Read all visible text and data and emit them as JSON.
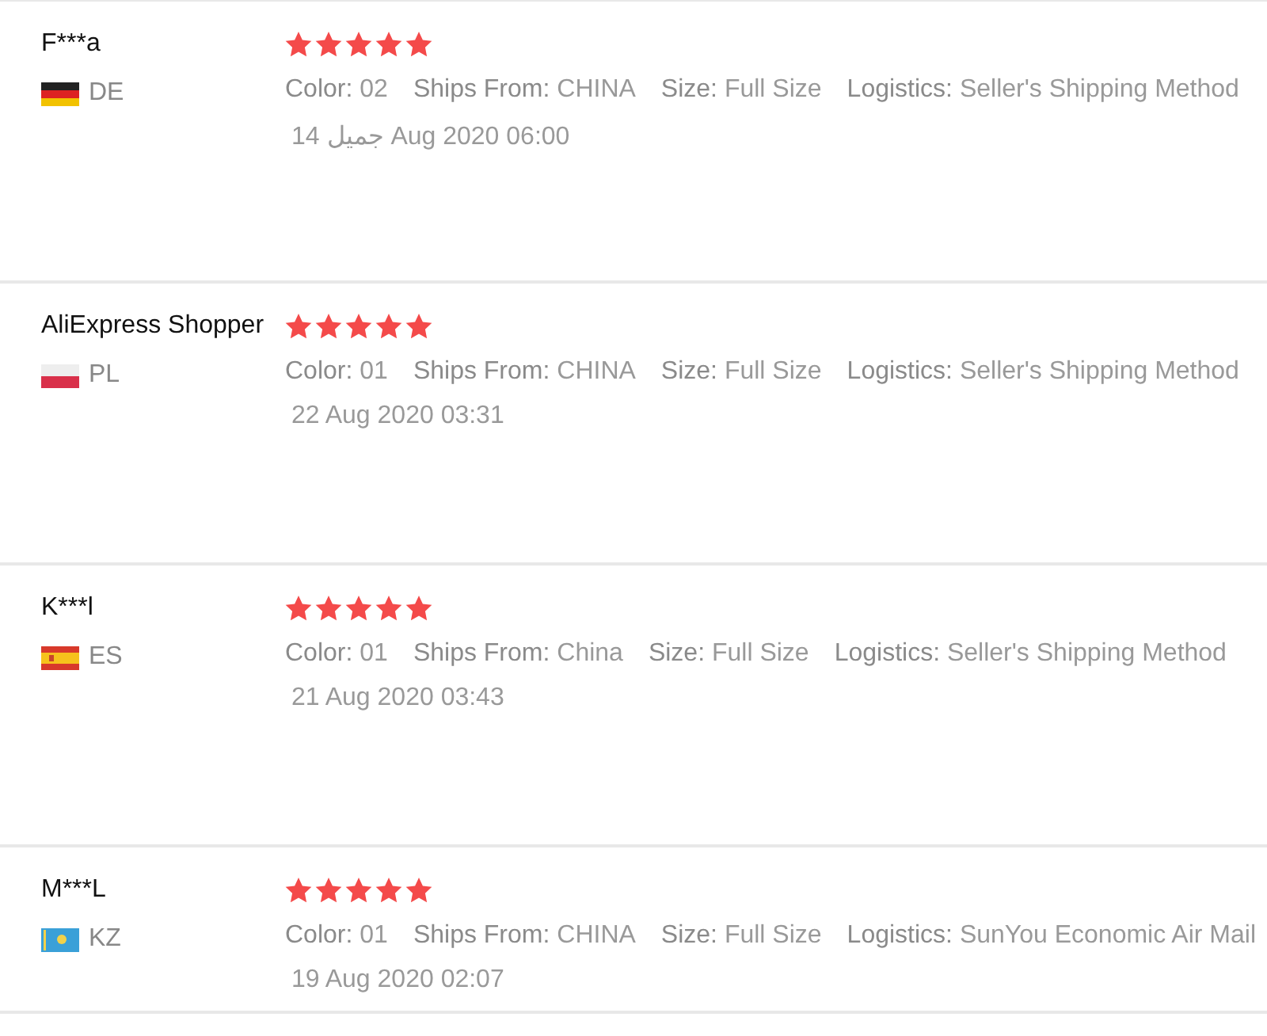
{
  "reviews": [
    {
      "name": "F***a",
      "flag": {
        "kind": "de"
      },
      "country": "DE",
      "stars": 5,
      "attributes": [
        {
          "label": "Color:",
          "value": "02"
        },
        {
          "label": "Ships From:",
          "value": "CHINA"
        },
        {
          "label": "Size:",
          "value": "Full Size"
        },
        {
          "label": "Logistics:",
          "value": "Seller's Shipping Method"
        }
      ],
      "date": "14 جميل Aug 2020 06:00"
    },
    {
      "name": "AliExpress Shopper",
      "flag": {
        "kind": "pl"
      },
      "country": "PL",
      "stars": 5,
      "attributes": [
        {
          "label": "Color:",
          "value": "01"
        },
        {
          "label": "Ships From:",
          "value": "CHINA"
        },
        {
          "label": "Size:",
          "value": "Full Size"
        },
        {
          "label": "Logistics:",
          "value": "Seller's Shipping Method"
        }
      ],
      "date": "22 Aug 2020 03:31"
    },
    {
      "name": "K***l",
      "flag": {
        "kind": "es"
      },
      "country": "ES",
      "stars": 5,
      "attributes": [
        {
          "label": "Color:",
          "value": "01"
        },
        {
          "label": "Ships From:",
          "value": "China"
        },
        {
          "label": "Size:",
          "value": "Full Size"
        },
        {
          "label": "Logistics:",
          "value": "Seller's Shipping Method"
        }
      ],
      "date": "21 Aug 2020 03:43"
    },
    {
      "name": "M***L",
      "flag": {
        "kind": "kz"
      },
      "country": "KZ",
      "stars": 5,
      "attributes": [
        {
          "label": "Color:",
          "value": "01"
        },
        {
          "label": "Ships From:",
          "value": "CHINA"
        },
        {
          "label": "Size:",
          "value": "Full Size"
        },
        {
          "label": "Logistics:",
          "value": "SunYou Economic Air Mail"
        }
      ],
      "date": "19 Aug 2020 02:07"
    }
  ]
}
